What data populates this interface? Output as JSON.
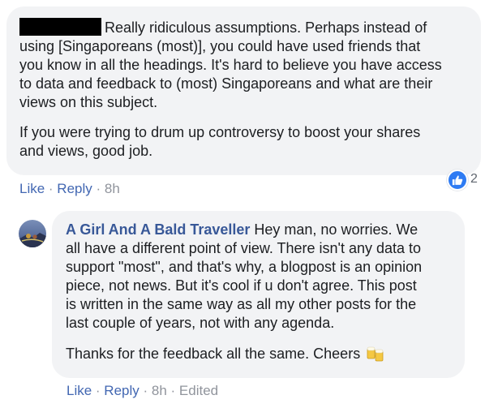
{
  "comment": {
    "text_lines": [
      "Really ridiculous assumptions. Perhaps instead of",
      "using [Singaporeans (most)], you could have used friends that",
      "you know in all the headings. It's hard to believe you have access",
      "to data and feedback to (most) Singaporeans and what are their",
      "views on this subject."
    ],
    "text2_lines": [
      "If you were trying to drum up controversy to boost your shares",
      "and views, good job."
    ],
    "actions": {
      "like": "Like",
      "sep1": " · ",
      "reply": "Reply",
      "sep2": " · ",
      "time": "8h"
    },
    "reaction": {
      "icon": "like-icon",
      "count": "2",
      "color": "#2e7bf3"
    }
  },
  "reply": {
    "author": "A Girl And A Bald Traveller",
    "first_line": " Hey man, no worries. We",
    "text_lines": [
      "all have a different point of view. There isn't any data to",
      "support \"most\", and that's why, a blogpost is an opinion",
      "piece, not news. But it's cool if u don't agree. This post",
      "is written in the same way as all my other posts for the",
      "last couple of years, not with any agenda."
    ],
    "text2": "Thanks for the feedback all the same. Cheers",
    "emoji": "beer-mugs-icon",
    "actions": {
      "like": "Like",
      "sep1": " · ",
      "reply": "Reply",
      "sep2": " · ",
      "time": "8h",
      "sep3": " · ",
      "edited": "Edited"
    }
  },
  "colors": {
    "bubble": "#f2f3f5",
    "link": "#4267b2",
    "author": "#385898",
    "meta": "#90949c"
  }
}
